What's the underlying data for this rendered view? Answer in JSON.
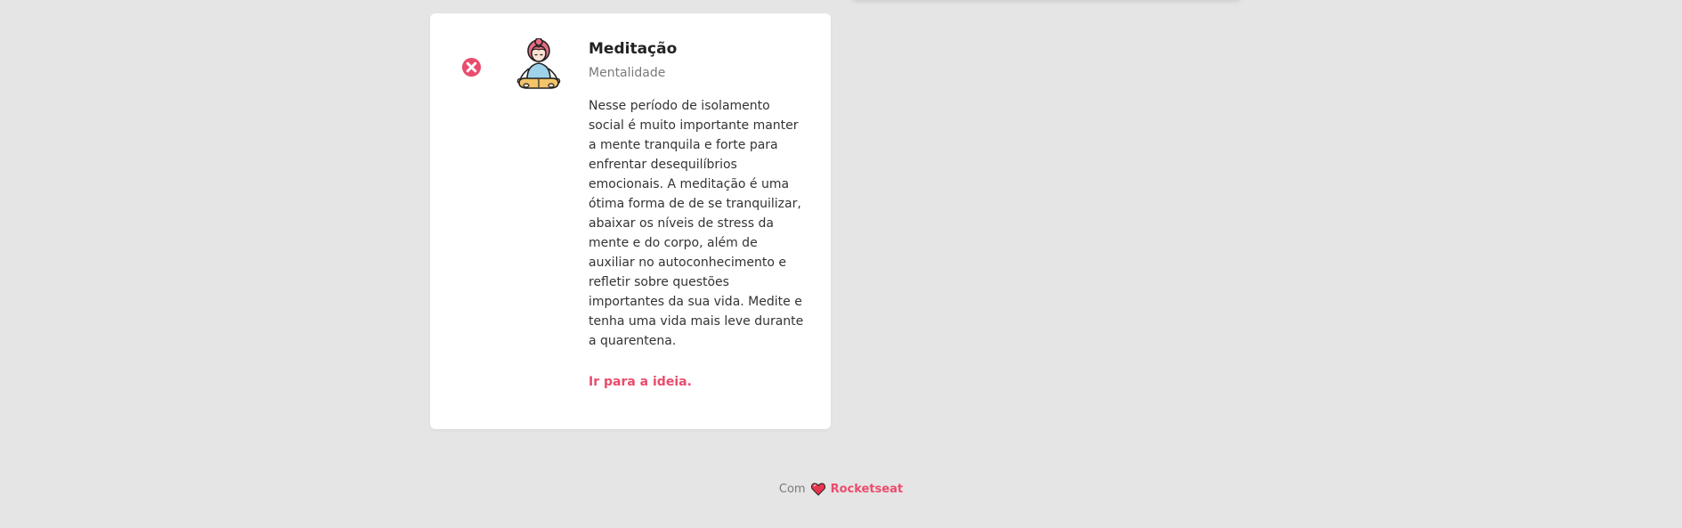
{
  "card": {
    "title": "Meditação",
    "category": "Mentalidade",
    "description": "Nesse período de isolamento social é muito importante manter a mente tranquila e forte para enfrentar desequilíbrios emocionais. A meditação é uma ótima forma de de se tranquilizar, abaixar os níveis de stress da mente e do corpo, além de auxiliar no autoconhecimento e refletir sobre questões importantes da sua vida. Medite e tenha uma vida mais leve durante a quarentena.",
    "link_label": "Ir para a ideia.",
    "remove_icon": "close-circle-icon",
    "illustration_icon": "meditation-icon"
  },
  "footer": {
    "prefix": "Com",
    "heart_icon": "heart-icon",
    "brand": "Rocketseat"
  },
  "colors": {
    "background": "#e5e5e5",
    "card": "#ffffff",
    "accent": "#ea4c6d"
  }
}
